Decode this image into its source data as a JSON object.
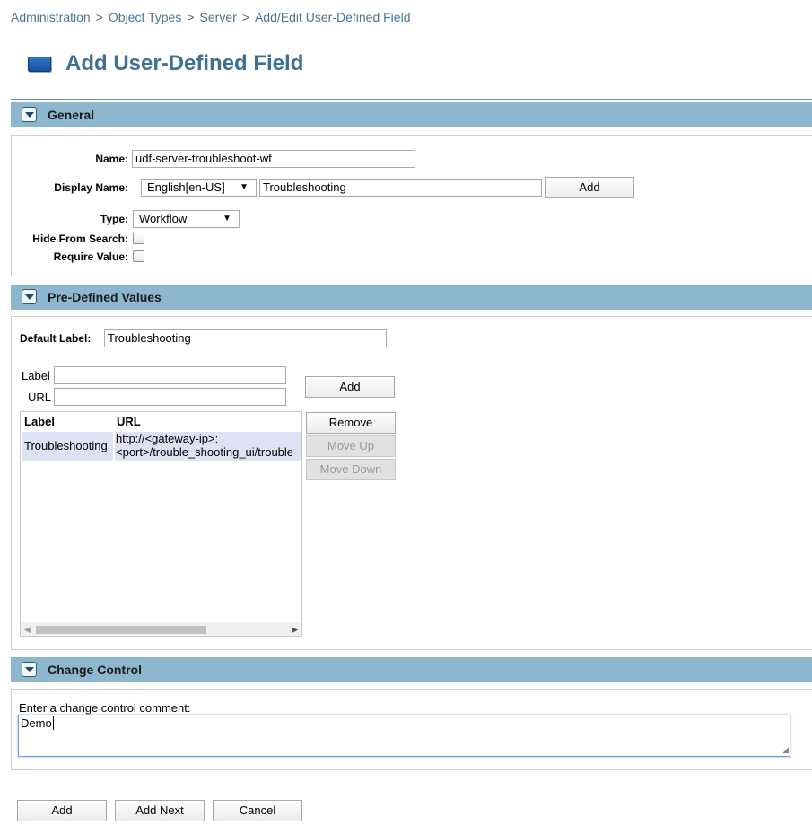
{
  "breadcrumb": [
    "Administration",
    "Object Types",
    "Server",
    "Add/Edit User-Defined Field"
  ],
  "breadcrumb_sep": ">",
  "page_title": "Add User-Defined Field",
  "sections": {
    "general": "General",
    "predefined": "Pre-Defined Values",
    "change_control": "Change Control"
  },
  "general": {
    "name_label": "Name:",
    "name_value": "udf-server-troubleshoot-wf",
    "display_name_label": "Display Name:",
    "language_value": "English[en-US]",
    "display_name_value": "Troubleshooting",
    "add_button": "Add",
    "type_label": "Type:",
    "type_value": "Workflow",
    "hide_from_search_label": "Hide From Search:",
    "require_value_label": "Require Value:"
  },
  "predefined": {
    "default_label_label": "Default Label:",
    "default_label_value": "Troubleshooting",
    "label_label": "Label",
    "url_label": "URL",
    "label_value": "",
    "url_value": "",
    "add_button": "Add",
    "remove_button": "Remove",
    "move_up_button": "Move Up",
    "move_down_button": "Move Down",
    "table": {
      "headers": [
        "Label",
        "URL"
      ],
      "rows": [
        {
          "label": "Troubleshooting",
          "url_line1": "http://<gateway-ip>:",
          "url_line2": "<port>/trouble_shooting_ui/trouble"
        }
      ]
    }
  },
  "change_control": {
    "prompt": "Enter a change control comment:",
    "comment": "Demo"
  },
  "footer": {
    "add": "Add",
    "add_next": "Add Next",
    "cancel": "Cancel"
  },
  "icons": {
    "title_icon": "blue-rectangle-icon",
    "section_toggle": "chevron-down-icon"
  },
  "colors": {
    "section_bar": "#8db7cf",
    "title": "#3f6f91",
    "breadcrumb": "#4a7392",
    "selected_row": "#dde3f5"
  }
}
